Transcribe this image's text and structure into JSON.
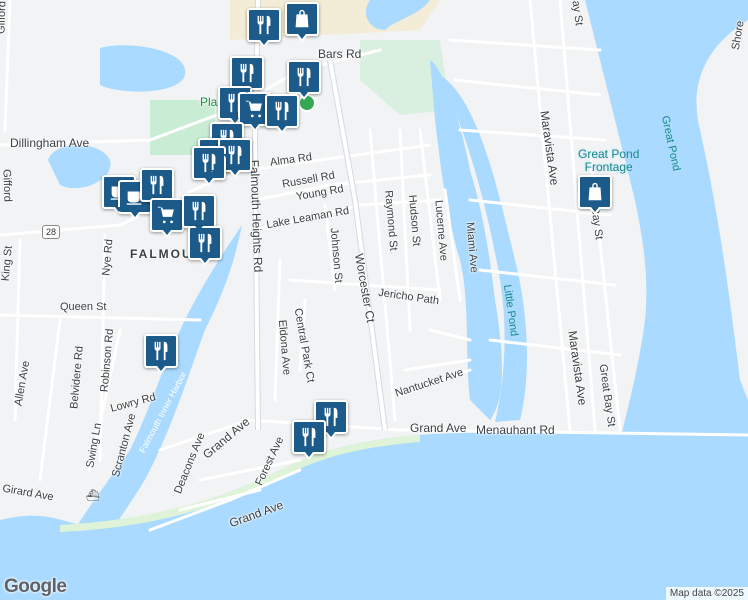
{
  "map": {
    "streets": [
      {
        "name": "Gifford",
        "label": "Gifford"
      },
      {
        "name": "bars",
        "label": "Bars Rd"
      },
      {
        "name": "dillingham",
        "label": "Dillingham Ave"
      },
      {
        "name": "alma",
        "label": "Alma Rd"
      },
      {
        "name": "russell",
        "label": "Russell Rd"
      },
      {
        "name": "young",
        "label": "Young Rd"
      },
      {
        "name": "lake-leaman",
        "label": "Lake Leaman Rd"
      },
      {
        "name": "raymond",
        "label": "Raymond St"
      },
      {
        "name": "hudson",
        "label": "Hudson St"
      },
      {
        "name": "lucerne",
        "label": "Lucerne Ave"
      },
      {
        "name": "miami",
        "label": "Miami Ave"
      },
      {
        "name": "johnson",
        "label": "Johnson St"
      },
      {
        "name": "worcester",
        "label": "Worcester Ct"
      },
      {
        "name": "jericho",
        "label": "Jericho Path"
      },
      {
        "name": "falmouth-heights",
        "label": "Falmouth Heights Rd"
      },
      {
        "name": "queen",
        "label": "Queen St"
      },
      {
        "name": "nye",
        "label": "Nye Rd"
      },
      {
        "name": "central-park",
        "label": "Central Park Ct"
      },
      {
        "name": "eldona",
        "label": "Eldona Ave"
      },
      {
        "name": "nantucket",
        "label": "Nantucket Ave"
      },
      {
        "name": "allen",
        "label": "Allen Ave"
      },
      {
        "name": "belvidere",
        "label": "Belvidere Rd"
      },
      {
        "name": "robinson",
        "label": "Robinson Rd"
      },
      {
        "name": "lowry",
        "label": "Lowry Rd"
      },
      {
        "name": "swing",
        "label": "Swing Ln"
      },
      {
        "name": "scranton",
        "label": "Scranton Ave"
      },
      {
        "name": "deacons",
        "label": "Deacons Ave"
      },
      {
        "name": "grand",
        "label": "Grand Ave"
      },
      {
        "name": "grand2",
        "label": "Grand Ave"
      },
      {
        "name": "grand3",
        "label": "Grand Ave"
      },
      {
        "name": "menauhant",
        "label": "Menauhant Rd"
      },
      {
        "name": "forest",
        "label": "Forest Ave"
      },
      {
        "name": "girard",
        "label": "Girard Ave"
      },
      {
        "name": "king",
        "label": "King St"
      },
      {
        "name": "maravista",
        "label": "Maravista Ave"
      },
      {
        "name": "maravista2",
        "label": "Maravista Ave"
      },
      {
        "name": "great-bay",
        "label": "Great Bay St"
      },
      {
        "name": "great-bay2",
        "label": "Bay St"
      },
      {
        "name": "shore",
        "label": "Shore"
      },
      {
        "name": "gifford2",
        "label": "Gifford"
      },
      {
        "name": "bay",
        "label": "Bay St"
      }
    ],
    "water_labels": {
      "little_pond": "Little Pond",
      "great_pond": "Great Pond",
      "inner_harbor": "Falmouth Inner Harbor",
      "frontage": "Great Pond\nFrontage"
    },
    "places": {
      "town": "FALMOU",
      "plaza": "Pla"
    },
    "route_shield": "28",
    "logo": "Google",
    "attribution": "Map data ©2025",
    "colors": {
      "water": "#aadaff",
      "land": "#f1f3f4",
      "park": "#c8ecd4",
      "pin": "#1c5a8a",
      "road": "#ffffff",
      "major_road": "#d6dadf"
    },
    "pins": [
      {
        "type": "restaurant",
        "icon": "fork-knife-icon"
      },
      {
        "type": "shopping",
        "icon": "shopping-bag-icon"
      },
      {
        "type": "restaurant",
        "icon": "fork-knife-icon"
      },
      {
        "type": "restaurant",
        "icon": "fork-knife-icon"
      },
      {
        "type": "restaurant",
        "icon": "fork-knife-icon"
      },
      {
        "type": "grocery",
        "icon": "shopping-cart-icon"
      },
      {
        "type": "restaurant",
        "icon": "fork-knife-icon"
      },
      {
        "type": "restaurant",
        "icon": "fork-knife-icon"
      },
      {
        "type": "restaurant",
        "icon": "fork-knife-icon"
      },
      {
        "type": "restaurant",
        "icon": "fork-knife-icon"
      },
      {
        "type": "restaurant",
        "icon": "fork-knife-icon"
      },
      {
        "type": "cafe",
        "icon": "coffee-cup-icon"
      },
      {
        "type": "cafe",
        "icon": "coffee-cup-icon"
      },
      {
        "type": "restaurant",
        "icon": "fork-knife-icon"
      },
      {
        "type": "grocery",
        "icon": "shopping-cart-icon"
      },
      {
        "type": "restaurant",
        "icon": "fork-knife-icon"
      },
      {
        "type": "restaurant",
        "icon": "fork-knife-icon"
      },
      {
        "type": "restaurant",
        "icon": "fork-knife-icon"
      },
      {
        "type": "restaurant",
        "icon": "fork-knife-icon"
      },
      {
        "type": "restaurant",
        "icon": "fork-knife-icon"
      },
      {
        "type": "shopping",
        "icon": "shopping-bag-icon"
      }
    ]
  }
}
